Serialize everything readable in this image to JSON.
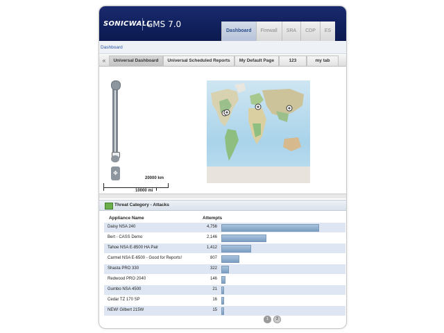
{
  "header": {
    "logo": "SONICWALL",
    "product": "GMS 7.0",
    "tabs": [
      "Dashboard",
      "Firewall",
      "SRA",
      "CDP",
      "ES"
    ]
  },
  "breadcrumb": "Dashboard",
  "subtabs": [
    "Universal Dashboard",
    "Universal Scheduled Reports",
    "My Default Page",
    "123",
    "my tab"
  ],
  "map": {
    "scale_km": "20000 km",
    "scale_mi": "10000 mi",
    "pins": 3
  },
  "panel": {
    "title": "Threat Category  -  Attacks",
    "col_name": "Appliance Name",
    "col_attempts": "Attempts",
    "rows": [
      {
        "name": "Daisy NSA 240",
        "attempts": "4,756",
        "value": 4756
      },
      {
        "name": "Bert - CASS Demo",
        "attempts": "2,146",
        "value": 2146
      },
      {
        "name": "Tahoe NSA E-8500 HA Pair",
        "attempts": "1,412",
        "value": 1412
      },
      {
        "name": "Carmel NSA E-6500 - Good for Reports!",
        "attempts": "807",
        "value": 807
      },
      {
        "name": "Shasta PRO 330",
        "attempts": "322",
        "value": 322
      },
      {
        "name": "Redwood PRO 2040",
        "attempts": "146",
        "value": 146
      },
      {
        "name": "Gumbo NSA 4500",
        "attempts": "21",
        "value": 21
      },
      {
        "name": "Cedar TZ 170 SP",
        "attempts": "16",
        "value": 16
      },
      {
        "name": "NEW! Gilbert 215W",
        "attempts": "15",
        "value": 15
      }
    ],
    "pages": [
      "1",
      "2"
    ]
  },
  "colors": {
    "header_bg": "#10205c",
    "bar_fill": "#7b9ec2",
    "row_alt": "#dde6f2"
  }
}
